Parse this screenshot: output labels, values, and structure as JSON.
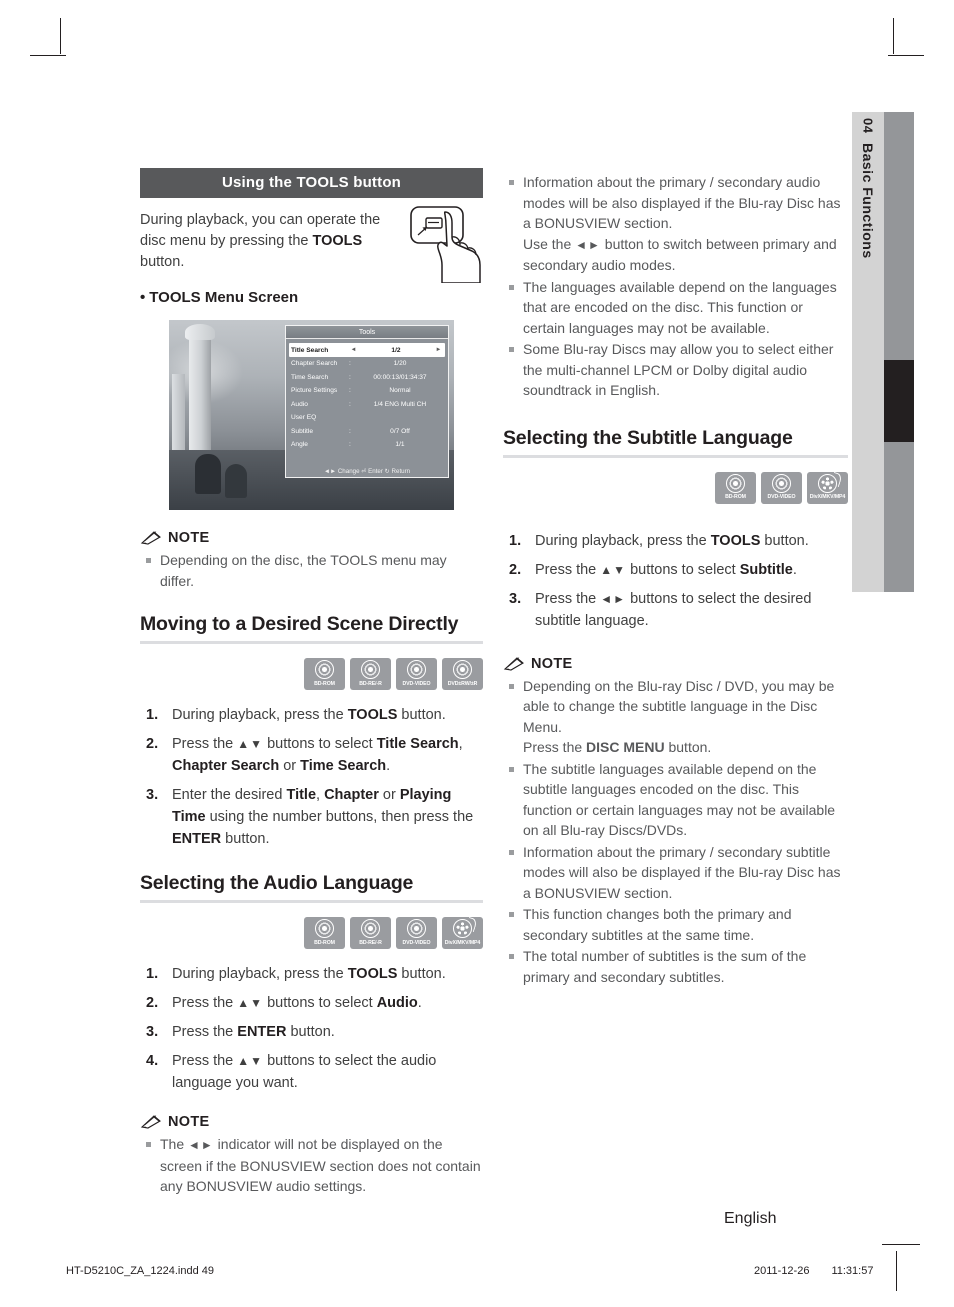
{
  "side_tab": {
    "number": "04",
    "label": "Basic Functions"
  },
  "left_column": {
    "section_bar": "Using the TOOLS button",
    "intro": {
      "before": "During playback, you can operate the disc menu by pressing the ",
      "bold": "TOOLS",
      "after": " button."
    },
    "subhead": "TOOLS Menu Screen",
    "osd": {
      "title": "Tools",
      "rows": [
        {
          "label": "Title Search",
          "sep": "",
          "value": "1/2",
          "selected": true
        },
        {
          "label": "Chapter Search",
          "sep": ":",
          "value": "1/20",
          "selected": false
        },
        {
          "label": "Time Search",
          "sep": ":",
          "value": "00:00:13/01:34:37",
          "selected": false
        },
        {
          "label": "Picture Settings",
          "sep": ":",
          "value": "Normal",
          "selected": false
        },
        {
          "label": "Audio",
          "sep": ":",
          "value": "1/4 ENG Multi CH",
          "selected": false
        },
        {
          "label": "User EQ",
          "sep": "",
          "value": "",
          "selected": false
        },
        {
          "label": "Subtitle",
          "sep": ":",
          "value": "0/7 Off",
          "selected": false
        },
        {
          "label": "Angle",
          "sep": ":",
          "value": "1/1",
          "selected": false
        }
      ],
      "footer": "◄► Change   ⏎ Enter   ↻ Return"
    },
    "note1": {
      "title": "NOTE",
      "items": [
        "Depending on the disc, the TOOLS menu may differ."
      ]
    },
    "section2": {
      "title": "Moving to a Desired Scene Directly",
      "discs": [
        "BD-ROM",
        "BD-RE/-R",
        "DVD-VIDEO",
        "DVD±RW/±R"
      ],
      "steps": [
        {
          "num": "1.",
          "html": "During playback, press the <b>TOOLS</b> button."
        },
        {
          "num": "2.",
          "html": "Press the <span class=\"arrows\">▲▼</span> buttons to select <b>Title Search</b>, <b>Chapter Search</b> or <b>Time Search</b>."
        },
        {
          "num": "3.",
          "html": "Enter the desired <b>Title</b>, <b>Chapter</b> or <b>Playing Time</b> using the number buttons, then press the <b>ENTER</b> button."
        }
      ]
    },
    "section3": {
      "title": "Selecting the Audio Language",
      "discs": [
        "BD-ROM",
        "BD-RE/-R",
        "DVD-VIDEO",
        "DivX/MKV/MP4"
      ],
      "steps": [
        {
          "num": "1.",
          "html": "During playback, press the <b>TOOLS</b> button."
        },
        {
          "num": "2.",
          "html": "Press the <span class=\"arrows\">▲▼</span> buttons to select <b>Audio</b>."
        },
        {
          "num": "3.",
          "html": "Press the <b>ENTER</b> button."
        },
        {
          "num": "4.",
          "html": "Press the <span class=\"arrows\">▲▼</span> buttons to select the audio language you want."
        }
      ]
    },
    "note2": {
      "title": "NOTE",
      "items_html": [
        "The <span class=\"arrows\">◄►</span> indicator will not be displayed on the screen if the BONUSVIEW section does not contain any BONUSVIEW audio settings."
      ]
    }
  },
  "right_column": {
    "top_notes_html": [
      "Information about the primary / secondary audio modes will be also displayed if the Blu-ray Disc has a BONUSVIEW section.<br>Use the <span class=\"arrows\">◄►</span> button to switch between primary and secondary audio modes.",
      "The languages available depend on the languages that are encoded on the disc. This function or certain languages may not be available.",
      "Some Blu-ray Discs may allow you to select either the multi-channel LPCM or Dolby digital audio soundtrack in English."
    ],
    "section": {
      "title": "Selecting the Subtitle Language",
      "discs": [
        "BD-ROM",
        "DVD-VIDEO",
        "DivX/MKV/MP4"
      ],
      "steps": [
        {
          "num": "1.",
          "html": "During playback, press the <b>TOOLS</b> button."
        },
        {
          "num": "2.",
          "html": "Press the <span class=\"arrows\">▲▼</span> buttons to select <b>Subtitle</b>."
        },
        {
          "num": "3.",
          "html": "Press the <span class=\"arrows\">◄►</span> buttons to select the desired subtitle language."
        }
      ]
    },
    "note": {
      "title": "NOTE",
      "items_html": [
        "Depending on the Blu-ray Disc / DVD, you may be able to change the subtitle language in the Disc Menu.<br>Press the <b>DISC MENU</b> button.",
        "The subtitle languages available depend on the subtitle languages encoded on the disc. This function or certain languages may not be available on all Blu-ray Discs/DVDs.",
        "Information about the primary / secondary subtitle modes will also be displayed if the Blu-ray Disc has a BONUSVIEW section.",
        "This function changes both the primary and secondary subtitles at the same time.",
        "The total number of subtitles is the sum of the primary and secondary subtitles."
      ]
    }
  },
  "footer": {
    "language": "English",
    "file": "HT-D5210C_ZA_1224.indd   49",
    "date": "2011-12-26",
    "time": "11:31:57"
  },
  "colors": {
    "bar": "#58595b",
    "side_tab": "#d3d3d3",
    "side_bar": "#949699",
    "disc_icon": "#9a9ca0",
    "rule": "#dcdde0"
  }
}
